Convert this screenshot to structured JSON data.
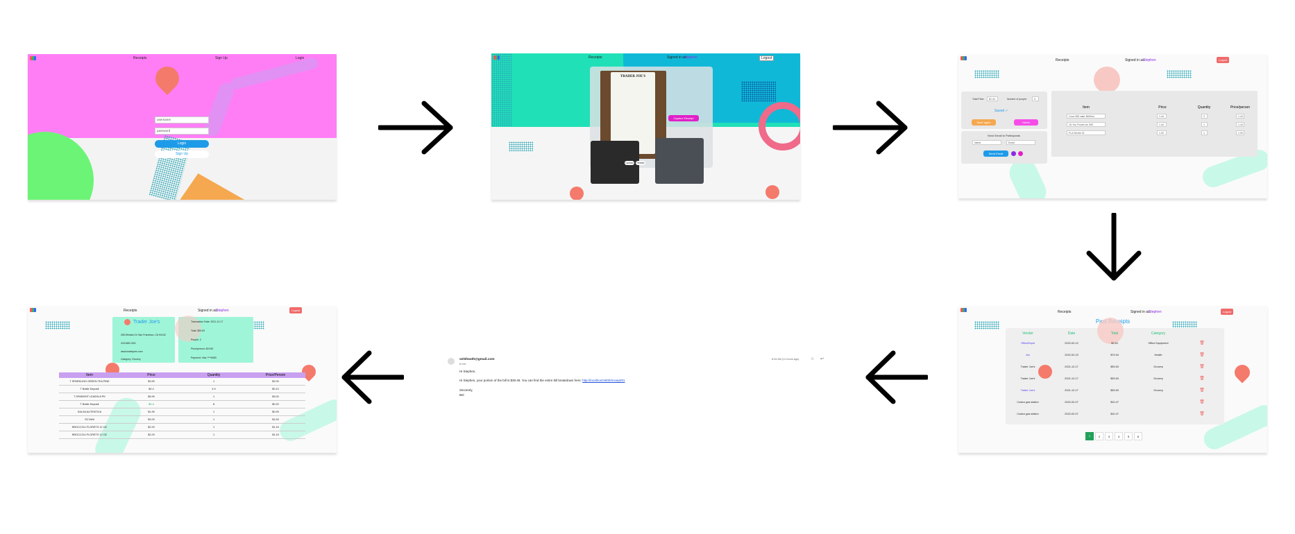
{
  "colors": {
    "accent_blue": "#1e9be8",
    "magenta": "#ff7ef6",
    "teal": "#20e0b8",
    "cyan": "#10b8d8",
    "salmon": "#f47a6c",
    "green_blob": "#6cf476",
    "orange": "#f5a850",
    "purple_row": "#c9a0f0",
    "mint": "#9ff5d8",
    "logout_red": "#f06a6a"
  },
  "login": {
    "nav": {
      "receipts": "Receipts",
      "signup": "Sign Up",
      "login": "Login"
    },
    "username_placeholder": "username",
    "password_placeholder": "password",
    "login_button": "Login",
    "signup_button": "Sign Up"
  },
  "capture": {
    "nav": {
      "receipts": "Receipts",
      "signed_in_as": "Signed in as:",
      "user": "Stephen",
      "logout": "Logout"
    },
    "receipt_header": "TRADER JOE'S",
    "capture_button": "Capture Receipt",
    "option_a": "Upload",
    "option_b": "Retake"
  },
  "split": {
    "nav": {
      "receipts": "Receipts",
      "signed_in_as": "Signed in as:",
      "user": "Stephen",
      "logout": "Logout"
    },
    "total_label": "Total Price:",
    "total_value": "$1.44",
    "people_label": "Number of people:",
    "people_value": "3",
    "saved_text": "Saved ✓",
    "save_again": "Save again",
    "home": "Home",
    "send_heading": "Send Email to Participants",
    "name_placeholder": "Name",
    "email_placeholder": "Email",
    "send_button": "Send Email",
    "columns": [
      "Item",
      "Price",
      "Quantity",
      "Price/person"
    ],
    "items": [
      {
        "name": "Coca 355 cake 3600ero",
        "price": "1.44",
        "qty": "2",
        "per": "1.44"
      },
      {
        "name": "JU You Frozen wr, 800",
        "price": "1.44",
        "qty": "1",
        "per": "1.44"
      },
      {
        "name": "FLA Servile 01",
        "price": "1.00",
        "qty": "1",
        "per": "1.00"
      }
    ]
  },
  "past": {
    "nav": {
      "receipts": "Receipts",
      "signed_in_as": "Signed in as:",
      "user": "Stephen",
      "logout": "Logout"
    },
    "title": "Past Receipts",
    "columns": [
      "Vendor",
      "Date",
      "Total",
      "Category"
    ],
    "rows": [
      {
        "vendor": "OfficeDepot",
        "date": "2022-02-12",
        "total": "$2.64",
        "category": "Office Equipment"
      },
      {
        "vendor": "Alo",
        "date": "2022-02-23",
        "total": "$73.94",
        "category": "Health"
      },
      {
        "vendor": "Trader Joe's",
        "date": "2021-12-17",
        "total": "$39.63",
        "category": "Grocery"
      },
      {
        "vendor": "Trader Joe's",
        "date": "2021-12-17",
        "total": "$39.63",
        "category": "Grocery"
      },
      {
        "vendor": "Trader Joe's",
        "date": "2021-12-17",
        "total": "$39.63",
        "category": "Grocery"
      },
      {
        "vendor": "Costco gas station",
        "date": "2022-02-07",
        "total": "$10.47",
        "category": ""
      },
      {
        "vendor": "Costco gas station",
        "date": "2022-02-07",
        "total": "$10.47",
        "category": ""
      }
    ],
    "pages": [
      "1",
      "2",
      "3",
      "4",
      "5",
      "6"
    ]
  },
  "email": {
    "sender": "sel3heath@gmail.com",
    "to": "to me",
    "time": "8:34 AM (11 hours ago)",
    "greeting": "Hi Stephen,",
    "body": "Hi Stephen, your portion of the bill is $39.48. You can find the entire bill breakdown here:",
    "link": "http://localhost:5000/receipt/81",
    "closing": "Sincerely,",
    "signature": "Bel"
  },
  "detail": {
    "nav": {
      "receipts": "Receipts",
      "signed_in_as": "Signed in as:",
      "user": "Stephen",
      "logout": "Logout"
    },
    "vendor": "Trader Joe's",
    "address": "265 Winston Dr San Francisco, CA 94132",
    "phone": "415-665-1001",
    "website": "www.traderjoes.com",
    "category": "Category: Grocery",
    "txn_date": "Transaction Date: 2021-12-17",
    "total": "Total: $39.63",
    "people": "People: 2",
    "pct": "Price/person: $19.82",
    "payment": "Payment: Visa ****6083",
    "columns": [
      "Item",
      "Price",
      "Quantity",
      "Price/Person"
    ],
    "items": [
      {
        "name": "T SPARKLING GREEN TEA PINE",
        "price": "$3.99",
        "qty": "1",
        "per": "$2.00"
      },
      {
        "name": "T Bottle Deposit",
        "price": "$0.2",
        "qty": "4.9",
        "per": "$0.10"
      },
      {
        "name": "T SPARKRIT LEMON 8 PK",
        "price": "$5.99",
        "qty": "1",
        "per": "$3.00"
      },
      {
        "name": "T Bottle Deposit",
        "price": "$0.4",
        "qty": "8",
        "per": "$0.20"
      },
      {
        "name": "SALSA AUTENTICA",
        "price": "$1.99",
        "qty": "1",
        "per": "$0.99"
      },
      {
        "name": "SCYANI",
        "price": "$3.29",
        "qty": "1",
        "per": "$1.63"
      },
      {
        "name": "BROCCOLI FLORETS 12 OZ",
        "price": "$2.29",
        "qty": "1",
        "per": "$1.15"
      },
      {
        "name": "BROCCOLI FLORETS 12 OZ",
        "price": "$2.29",
        "qty": "1",
        "per": "$1.15"
      }
    ]
  }
}
